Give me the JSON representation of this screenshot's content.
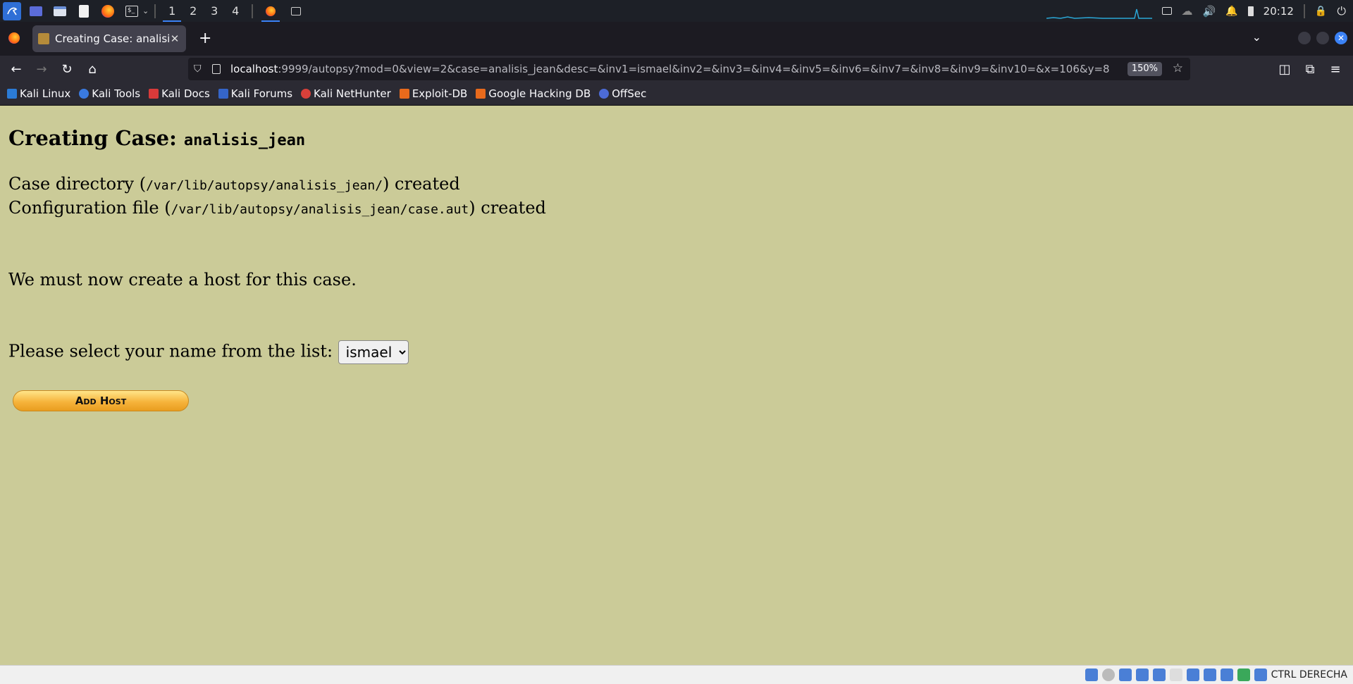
{
  "taskbar": {
    "workspaces": [
      "1",
      "2",
      "3",
      "4"
    ],
    "active_workspace": "1",
    "clock": "20:12"
  },
  "browser": {
    "tab_title": "Creating Case: analisis_je",
    "url_host": "localhost",
    "url_rest": ":9999/autopsy?mod=0&view=2&case=analisis_jean&desc=&inv1=ismael&inv2=&inv3=&inv4=&inv5=&inv6=&inv7=&inv8=&inv9=&inv10=&x=106&y=8",
    "zoom": "150%",
    "bookmarks": [
      "Kali Linux",
      "Kali Tools",
      "Kali Docs",
      "Kali Forums",
      "Kali NetHunter",
      "Exploit-DB",
      "Google Hacking DB",
      "OffSec"
    ]
  },
  "page": {
    "heading_prefix": "Creating Case: ",
    "case_name": "analisis_jean",
    "case_dir_prefix": "Case directory (",
    "case_dir_path": "/var/lib/autopsy/analisis_jean/",
    "case_dir_suffix": ") created",
    "config_prefix": "Configuration file (",
    "config_path": "/var/lib/autopsy/analisis_jean/case.aut",
    "config_suffix": ") created",
    "host_message": "We must now create a host for this case.",
    "select_label": "Please select your name from the list: ",
    "selected_name": "ismael",
    "add_host_label": "Add Host"
  },
  "statusbar": {
    "host_key": "CTRL DERECHA"
  },
  "colors": {
    "page_background": "#cbcb98",
    "button_gold": "#f6b43c",
    "accent_blue": "#3b82f6"
  }
}
